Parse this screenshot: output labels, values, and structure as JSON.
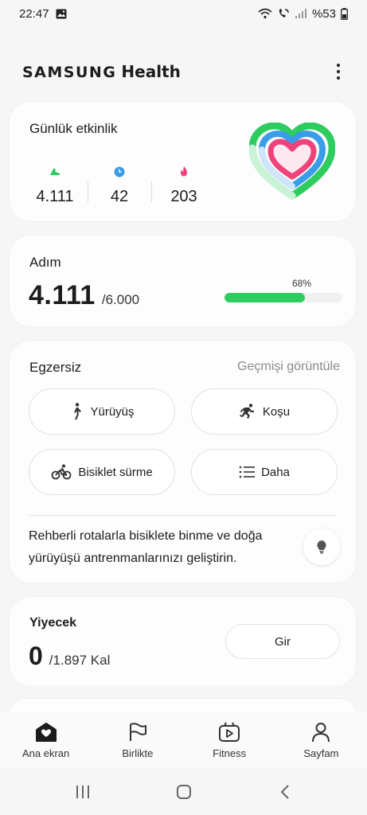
{
  "status_bar": {
    "time": "22:47",
    "battery": "%53"
  },
  "header": {
    "brand_samsung": "SAMSUNG",
    "brand_health": "Health"
  },
  "daily_activity": {
    "title": "Günlük etkinlik",
    "steps": "4.111",
    "active_minutes": "42",
    "calories": "203",
    "colors": {
      "steps": "#2ecc5f",
      "minutes": "#3b9ce8",
      "calories": "#f0427a"
    }
  },
  "steps_card": {
    "title": "Adım",
    "value": "4.111",
    "goal": "/6.000",
    "progress_label": "68%",
    "progress_percent": 68
  },
  "exercise": {
    "title": "Egzersiz",
    "history_link": "Geçmişi görüntüle",
    "buttons": {
      "walk": "Yürüyüş",
      "run": "Koşu",
      "cycle": "Bisiklet sürme",
      "more": "Daha"
    },
    "tip": "Rehberli rotalarla bisiklete binme ve doğa yürüyüşü antrenmanlarınızı geliştirin."
  },
  "food": {
    "title": "Yiyecek",
    "value": "0",
    "goal": "/1.897 Kal",
    "enter_button": "Gir"
  },
  "bottom_nav": [
    {
      "label": "Ana ekran",
      "icon": "home-heart-icon"
    },
    {
      "label": "Birlikte",
      "icon": "flag-icon"
    },
    {
      "label": "Fitness",
      "icon": "play-video-icon"
    },
    {
      "label": "Sayfam",
      "icon": "person-icon"
    }
  ],
  "accent_color": "#2ecc5f"
}
